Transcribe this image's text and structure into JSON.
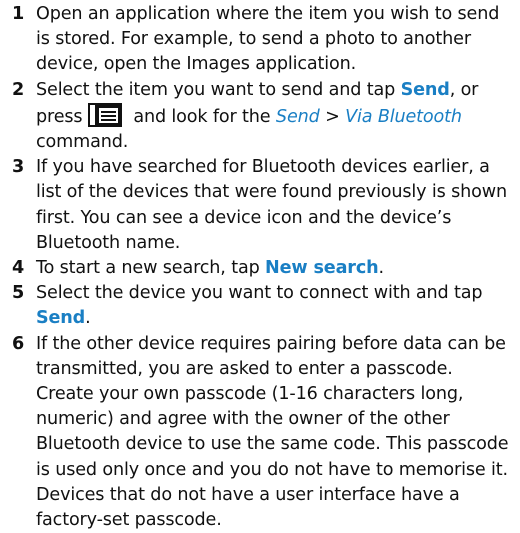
{
  "steps": [
    {
      "number": "1",
      "text": "Open an application where the item you wish to send is stored. For example, to send a photo to another device, open the Images application."
    },
    {
      "number": "2",
      "text_before": "Select the item you want to send and tap ",
      "command": "Send",
      "text_mid": ", or press ",
      "icon": "menu-key-icon",
      "text_after_icon": " and look for the ",
      "menu_path_1": "Send",
      "menu_separator": " > ",
      "menu_path_2": "Via Bluetooth",
      "text_end": " command."
    },
    {
      "number": "3",
      "text": "If you have searched for Bluetooth devices earlier, a list of the devices that were found previously is shown first. You can see a device icon and the device’s Bluetooth name."
    },
    {
      "number": "4",
      "text_before": "To start a new search, tap ",
      "command": "New search",
      "text_end": "."
    },
    {
      "number": "5",
      "text_before": "Select the device you want to connect with and tap ",
      "command": "Send",
      "text_end": "."
    },
    {
      "number": "6",
      "text": "If the other device requires pairing before data can be transmitted, you are asked to enter a passcode. Create your own passcode (1-16 characters long, numeric) and agree with the owner of the other Bluetooth device to use the same code. This passcode is used only once and you do not have to memorise it. Devices that do not have a user interface have a factory-set passcode."
    }
  ],
  "colors": {
    "link": "#1a7fc4",
    "text": "#111111",
    "icon_bg": "#111111",
    "icon_fg": "#ffffff"
  }
}
